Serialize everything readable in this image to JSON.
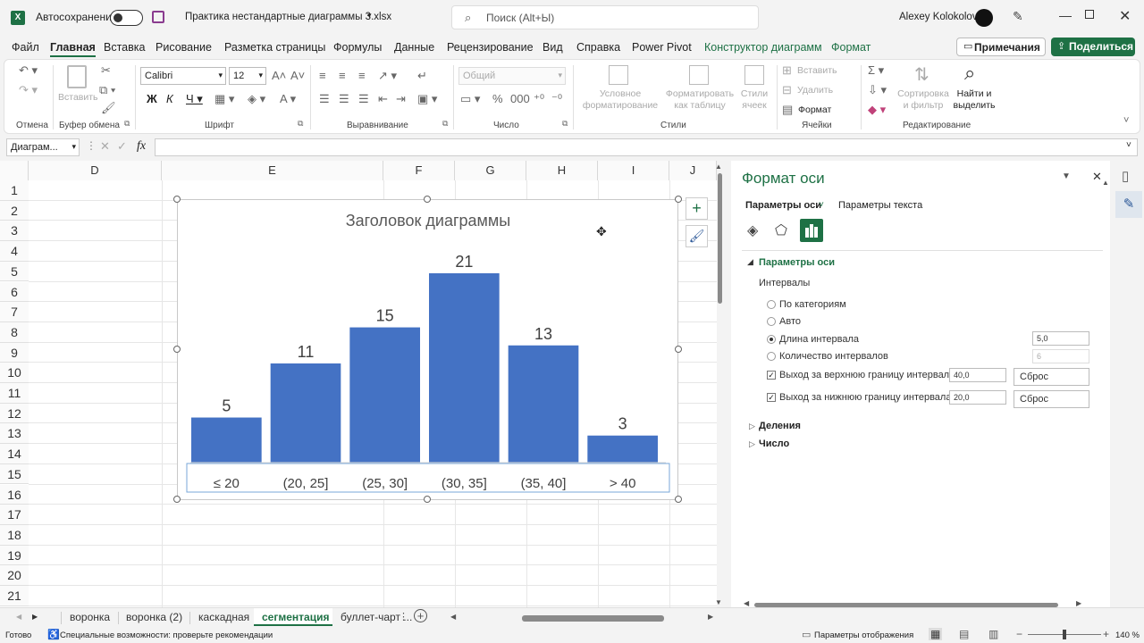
{
  "titlebar": {
    "autosave_label": "Автосохранение",
    "doc_title": "Практика нестандартные диаграммы 3.xlsx",
    "search_placeholder": "Поиск (Alt+Ы)",
    "user_name": "Alexey Kolokolov"
  },
  "menu": {
    "tabs": [
      "Файл",
      "Главная",
      "Вставка",
      "Рисование",
      "Разметка страницы",
      "Формулы",
      "Данные",
      "Рецензирование",
      "Вид",
      "Справка",
      "Power Pivot",
      "Конструктор диаграмм",
      "Формат"
    ],
    "comments_label": "Примечания",
    "share_label": "Поделиться"
  },
  "ribbon": {
    "undo_group": "Отмена",
    "clipboard_group": "Буфер обмена",
    "paste_label": "Вставить",
    "font_group": "Шрифт",
    "font_name": "Calibri",
    "font_size": "12",
    "align_group": "Выравнивание",
    "number_group": "Число",
    "number_format": "Общий",
    "styles_group": "Стили",
    "cond_format": "Условное форматирование",
    "format_table": "Форматировать как таблицу",
    "cell_styles": "Стили ячеек",
    "cells_group": "Ячейки",
    "insert": "Вставить",
    "delete": "Удалить",
    "format": "Формат",
    "editing_group": "Редактирование",
    "sort_filter": "Сортировка и фильтр",
    "find_select": "Найти и выделить"
  },
  "formula_bar": {
    "name_box": "Диаграм...",
    "fx": "fx"
  },
  "grid": {
    "columns": [
      "D",
      "E",
      "F",
      "G",
      "H",
      "I",
      "J"
    ],
    "rows": [
      "1",
      "2",
      "3",
      "4",
      "5",
      "6",
      "7",
      "8",
      "9",
      "10",
      "11",
      "12",
      "13",
      "14",
      "15",
      "16",
      "17",
      "18",
      "19",
      "20",
      "21"
    ]
  },
  "chart_data": {
    "type": "bar",
    "title": "Заголовок диаграммы",
    "categories": [
      "≤ 20",
      "(20, 25]",
      "(25, 30]",
      "(30, 35]",
      "(35, 40]",
      "> 40"
    ],
    "values": [
      5,
      11,
      15,
      21,
      13,
      3
    ],
    "value_labels": [
      "5",
      "11",
      "15",
      "21",
      "13",
      "3"
    ],
    "ylim": [
      0,
      21
    ],
    "bar_color": "#4472c4",
    "grid": false,
    "legend": "none"
  },
  "format_pane": {
    "title": "Формат оси",
    "tab_axis": "Параметры оси",
    "tab_text": "Параметры текста",
    "section_axis": "Параметры оси",
    "intervals_label": "Интервалы",
    "by_category": "По категориям",
    "auto": "Авто",
    "bin_width": "Длина интервала",
    "bin_width_value": "5,0",
    "bin_count": "Количество интервалов",
    "bin_count_value": "6",
    "overflow": "Выход за верхнюю границу интервала",
    "overflow_value": "40,0",
    "underflow": "Выход за нижнюю границу интервала",
    "underflow_value": "20,0",
    "reset": "Сброс",
    "section_ticks": "Деления",
    "section_number": "Число"
  },
  "sheets": {
    "tabs": [
      "воронка",
      "воронка (2)",
      "каскадная",
      "сегментация",
      "буллет-чарт ..."
    ],
    "active": "сегментация"
  },
  "status": {
    "ready": "Готово",
    "accessibility": "Специальные возможности: проверьте рекомендации",
    "display_settings": "Параметры отображения",
    "zoom": "140 %"
  }
}
